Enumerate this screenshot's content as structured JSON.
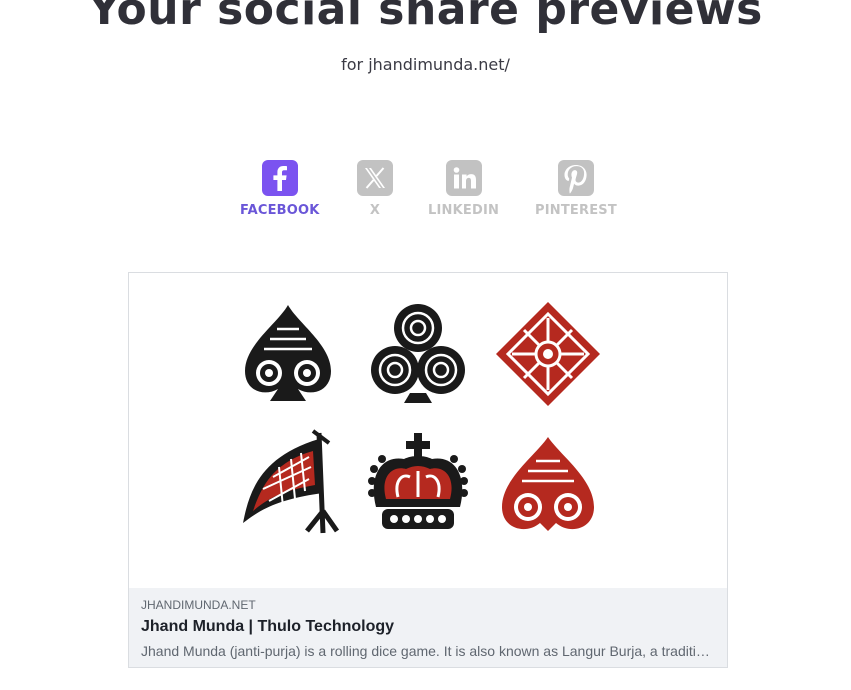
{
  "header": {
    "title": "Your social share previews",
    "subtitle": "for jhandimunda.net/"
  },
  "tabs": [
    {
      "label": "FACEBOOK",
      "icon": "facebook-icon",
      "active": true
    },
    {
      "label": "X",
      "icon": "x-icon",
      "active": false
    },
    {
      "label": "LINKEDIN",
      "icon": "linkedin-icon",
      "active": false
    },
    {
      "label": "PINTEREST",
      "icon": "pinterest-icon",
      "active": false
    }
  ],
  "preview": {
    "domain": "JHANDIMUNDA.NET",
    "title": "Jhand Munda | Thulo Technology",
    "description": "Jhand Munda (janti-purja) is a rolling dice game. It is also known as Langur Burja, a traditional dice game played in Nepal",
    "image_symbols": [
      "spade-icon",
      "club-icon",
      "diamond-icon",
      "flag-icon",
      "crown-icon",
      "heart-icon"
    ]
  },
  "colors": {
    "accent": "#7b53f0",
    "accent_text": "#6a56d8",
    "inactive": "#c2c2c2",
    "symbol_black": "#1a1a1a",
    "symbol_red": "#b5291f"
  }
}
